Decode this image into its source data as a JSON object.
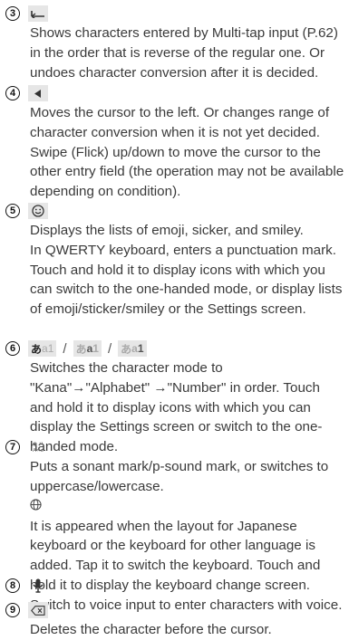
{
  "items": [
    {
      "num": "3",
      "icon": "back-arrow-icon",
      "lines": [
        "Shows characters entered by Multi-tap input (P.62) in the order that is reverse of the regular one. Or undoes character conversion after it is decided."
      ]
    },
    {
      "num": "4",
      "icon": "left-triangle-icon",
      "lines": [
        "Moves the cursor to the left. Or changes range of character conversion when it is not yet decided. Swipe (Flick) up/down to move the cursor to the other entry field (the operation may not be available depending on condition)."
      ]
    },
    {
      "num": "5",
      "icon": "smiley-icon",
      "lines": [
        "Displays the lists of emoji, sicker, and smiley.",
        "In QWERTY keyboard, enters a punctuation mark. Touch and hold it to display icons with which you can switch to the one-handed mode, or display lists of emoji/sticker/smiley or the Settings screen."
      ]
    },
    {
      "num": "6",
      "icon": "mode-switch-keys",
      "key_labels": {
        "kana": "あ",
        "alpha": "a",
        "num": "1"
      },
      "separator": "/",
      "lines": [
        "Switches the character mode to \"Kana\"→\"Alphabet\" →\"Number\" in order. Touch and hold it to display icons with which you can display the Settings screen or switch to the one-handed mode."
      ]
    },
    {
      "num": "7",
      "icon": "dakuten-icon",
      "lines": [
        "Puts a sonant mark/p-sound mark, or switches to uppercase/lowercase."
      ],
      "sub_icon": "globe-icon",
      "sub_lines": [
        "It is appeared when the layout for Japanese keyboard or the keyboard for other language is added. Tap it to switch the keyboard. Touch and hold it to display the keyboard change screen."
      ]
    },
    {
      "num": "8",
      "icon": "microphone-icon",
      "lines": [
        "Switch to voice input to enter characters with voice."
      ]
    },
    {
      "num": "9",
      "icon": "delete-icon",
      "lines": [
        "Deletes the character before the cursor."
      ]
    }
  ]
}
